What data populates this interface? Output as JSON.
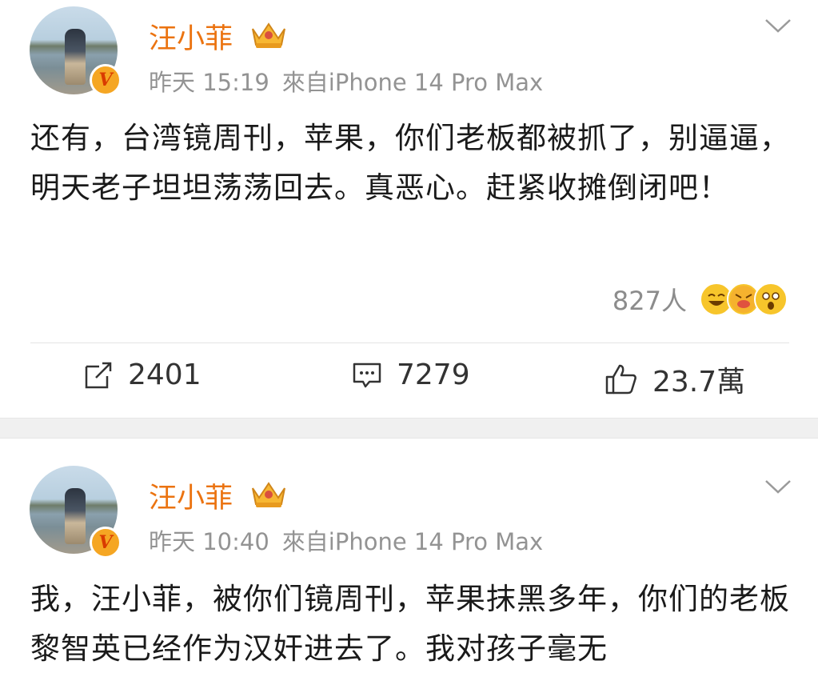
{
  "posts": [
    {
      "username": "汪小菲",
      "time": "昨天 15:19",
      "source": "來自iPhone 14 Pro Max",
      "content": "还有，台湾镜周刊，苹果，你们老板都被抓了，别逼逼，明天老子坦坦荡荡回去。真恶心。赶紧收摊倒闭吧！",
      "reactions_count": "827人",
      "reaction_icons": [
        "laughing-emoji",
        "tongue-emoji",
        "surprised-emoji"
      ],
      "reposts": "2401",
      "comments": "7279",
      "likes": "23.7萬"
    },
    {
      "username": "汪小菲",
      "time": "昨天 10:40",
      "source": "來自iPhone 14 Pro Max",
      "content": "我，汪小菲，被你们镜周刊，苹果抹黑多年，你们的老板黎智英已经作为汉奸进去了。我对孩子毫无"
    }
  ],
  "colors": {
    "username": "#eb7310",
    "meta_gray": "#939393",
    "badge_orange": "#f5a623",
    "separator": "#f0f0f0"
  },
  "icons": {
    "repost": "repost-icon",
    "comment": "comment-icon",
    "like": "thumbs-up-icon",
    "menu": "chevron-down-icon",
    "verified": "verified-v-badge-icon",
    "member": "crown-icon"
  }
}
